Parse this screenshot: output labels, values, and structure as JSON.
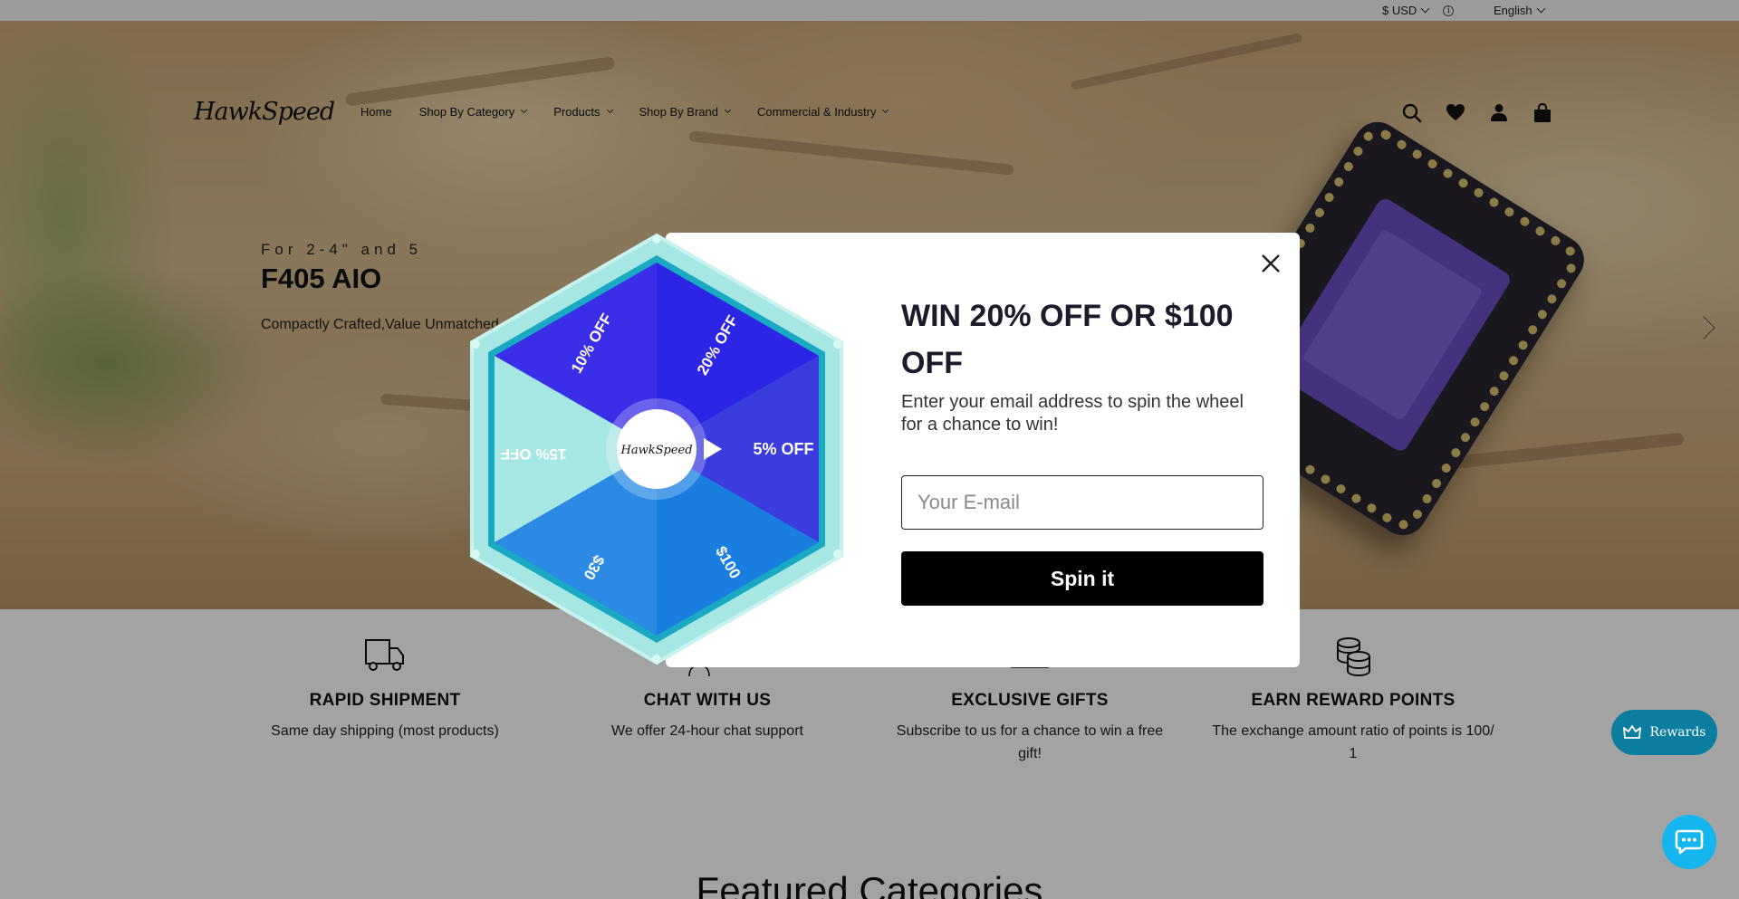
{
  "topbar": {
    "currency": "$ USD",
    "language": "English"
  },
  "header": {
    "logo": "HawkSpeed",
    "nav": [
      {
        "label": "Home",
        "has_dropdown": false
      },
      {
        "label": "Shop By Category",
        "has_dropdown": true
      },
      {
        "label": "Products",
        "has_dropdown": true
      },
      {
        "label": "Shop By Brand",
        "has_dropdown": true
      },
      {
        "label": "Commercial & Industry",
        "has_dropdown": true
      }
    ],
    "icons": [
      "search-icon",
      "heart-icon",
      "user-icon",
      "bag-icon"
    ]
  },
  "hero": {
    "subtitle": "For 2-4\" and 5",
    "title": "F405 AIO",
    "description": "Compactly Crafted,Value Unmatched"
  },
  "popup": {
    "title": "WIN 20% OFF OR $100 OFF",
    "text": "Enter your email address to spin the wheel for a chance to win!",
    "email_placeholder": "Your E-mail",
    "button": "Spin it",
    "wheel_center_logo": "HawkSpeed",
    "wheel_segments": [
      "10% OFF",
      "20% OFF",
      "5% OFF",
      "$100",
      "$30",
      "15% OFF"
    ]
  },
  "features": [
    {
      "icon": "truck-icon",
      "title": "RAPID SHIPMENT",
      "description": "Same day shipping (most products)"
    },
    {
      "icon": "chat-support-icon",
      "title": "CHAT WITH US",
      "description": "We offer 24-hour chat support"
    },
    {
      "icon": "envelope-icon",
      "title": "EXCLUSIVE GIFTS",
      "description": "Subscribe to us for a chance to win a free gift!"
    },
    {
      "icon": "coins-icon",
      "title": "EARN REWARD POINTS",
      "description": "The exchange amount ratio of points is 100/ 1"
    }
  ],
  "featured_heading": "Featured Categories",
  "rewards": {
    "label": "Rewards"
  },
  "colors": {
    "accent_teal": "#0b7ea0",
    "chat_blue": "#15b5ef",
    "wheel_border": "#a6e7e3",
    "wheel_dark": "#2d25e6"
  }
}
